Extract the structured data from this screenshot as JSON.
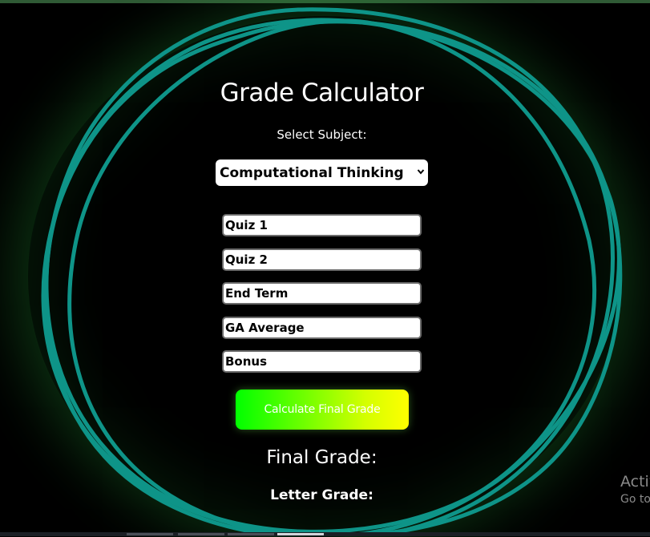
{
  "app": {
    "title": "Grade Calculator",
    "select_label": "Select Subject:"
  },
  "subject": {
    "selected": "Computational Thinking",
    "dropdown_icon": "chevron-down-icon"
  },
  "fields": {
    "quiz1_placeholder": "Quiz 1",
    "quiz1_value": "",
    "quiz2_placeholder": "Quiz 2",
    "quiz2_value": "",
    "endterm_placeholder": "End Term",
    "endterm_value": "",
    "ga_placeholder": "GA Average",
    "ga_value": "",
    "bonus_placeholder": "Bonus",
    "bonus_value": ""
  },
  "actions": {
    "calculate_label": "Calculate Final Grade"
  },
  "results": {
    "final_grade_label": "Final Grade:",
    "letter_grade_label": "Letter Grade:"
  },
  "watermark": {
    "title": "Activ",
    "subtitle": "Go to"
  },
  "colors": {
    "background": "#000000",
    "ring": "#0e9488",
    "button_gradient_start": "#00ff00",
    "button_gradient_end": "#ffff00",
    "text": "#ffffff"
  }
}
